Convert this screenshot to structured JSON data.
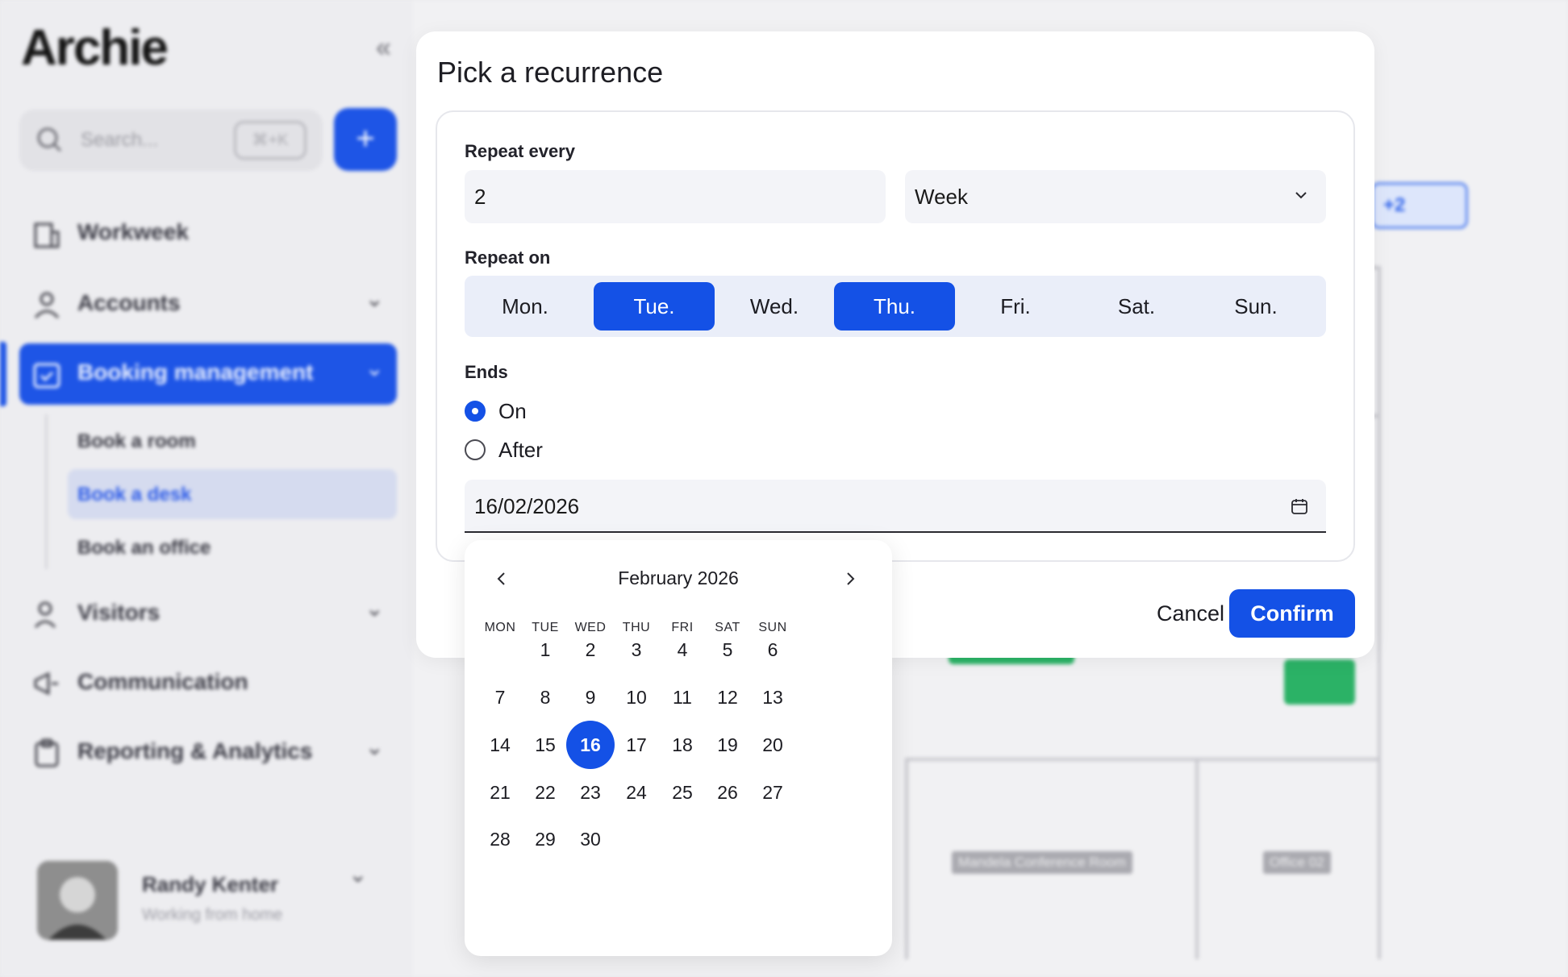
{
  "app": {
    "logo": "Archie",
    "search_placeholder": "Search...",
    "search_shortcut": "⌘+K",
    "add_label": "+"
  },
  "sidebar": {
    "items": [
      {
        "label": "Workweek",
        "icon": "building-icon",
        "expandable": false
      },
      {
        "label": "Accounts",
        "icon": "user-icon",
        "expandable": true
      },
      {
        "label": "Booking management",
        "icon": "calendar-check-icon",
        "expandable": true,
        "active": true
      },
      {
        "label": "Visitors",
        "icon": "visitor-icon",
        "expandable": true
      },
      {
        "label": "Communication",
        "icon": "megaphone-icon",
        "expandable": false
      },
      {
        "label": "Reporting & Analytics",
        "icon": "clipboard-icon",
        "expandable": true
      }
    ],
    "sub_items": [
      {
        "label": "Book a room"
      },
      {
        "label": "Book a desk",
        "active": true
      },
      {
        "label": "Book an office"
      }
    ]
  },
  "user": {
    "name": "Randy Kenter",
    "status": "Working from home"
  },
  "background": {
    "filter_pill": "+2",
    "room_label_1": "Mandela Conference Room",
    "room_label_2": "Office 02"
  },
  "modal": {
    "title": "Pick a recurrence",
    "repeat_every_label": "Repeat every",
    "repeat_every_value": "2",
    "repeat_unit": "Week",
    "repeat_on_label": "Repeat on",
    "days": [
      {
        "label": "Mon.",
        "selected": false
      },
      {
        "label": "Tue.",
        "selected": true
      },
      {
        "label": "Wed.",
        "selected": false
      },
      {
        "label": "Thu.",
        "selected": true
      },
      {
        "label": "Fri.",
        "selected": false
      },
      {
        "label": "Sat.",
        "selected": false
      },
      {
        "label": "Sun.",
        "selected": false
      }
    ],
    "ends_label": "Ends",
    "ends_options": [
      {
        "label": "On",
        "checked": true
      },
      {
        "label": "After",
        "checked": false
      }
    ],
    "end_date": "16/02/2026",
    "cancel_label": "Cancel",
    "confirm_label": "Confirm"
  },
  "calendar": {
    "month_label": "February 2026",
    "weekdays": [
      "MON",
      "TUE",
      "WED",
      "THU",
      "FRI",
      "SAT",
      "SUN"
    ],
    "weeks": [
      [
        "",
        "1",
        "2",
        "3",
        "4",
        "5",
        "6"
      ],
      [
        "7",
        "8",
        "9",
        "10",
        "11",
        "12",
        "13"
      ],
      [
        "14",
        "15",
        "16",
        "17",
        "18",
        "19",
        "20"
      ],
      [
        "21",
        "22",
        "23",
        "24",
        "25",
        "26",
        "27"
      ],
      [
        "28",
        "29",
        "30",
        "",
        "",
        "",
        ""
      ]
    ],
    "selected_day": "16"
  },
  "colors": {
    "accent": "#1451e6",
    "sidebar_active": "#1e55e6"
  }
}
